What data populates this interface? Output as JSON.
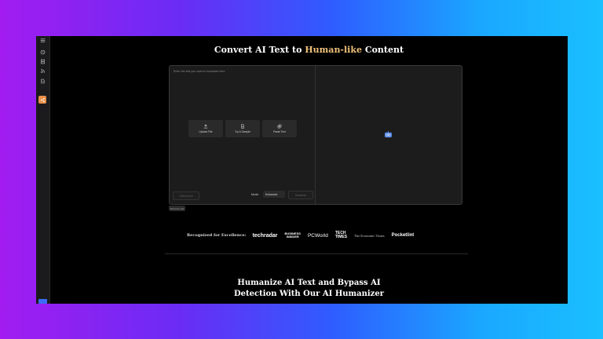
{
  "heading": {
    "prefix": "Convert AI Text to",
    "highlight": "Human-like",
    "suffix": "Content",
    "highlight_color": "#f0c27a"
  },
  "sidebar": {
    "icons": [
      "menu-icon",
      "history-icon",
      "document-icon",
      "rss-icon",
      "file-icon",
      "share-icon"
    ]
  },
  "editor": {
    "placeholder": "Enter the text you want to humanize here",
    "actions": [
      {
        "label": "Upload File",
        "icon": "upload-icon"
      },
      {
        "label": "Try A Sample",
        "icon": "document-icon"
      },
      {
        "label": "Paste Text",
        "icon": "paste-icon"
      }
    ],
    "check_label": "Check for AI",
    "mode_label": "Mode:",
    "mode_value": "Enhanced",
    "humanize_label": "Humanize",
    "terms_label": "Terms for use"
  },
  "recognized": {
    "label": "Recognized for Excellence:",
    "logos": [
      "techradar",
      "BUSINESS INSIDER",
      "PCWorld",
      "TECH TIMES",
      "The Economic Times",
      "Pocketlint"
    ]
  },
  "section": {
    "line1": "Humanize AI Text and Bypass AI",
    "line2": "Detection With Our AI Humanizer"
  }
}
